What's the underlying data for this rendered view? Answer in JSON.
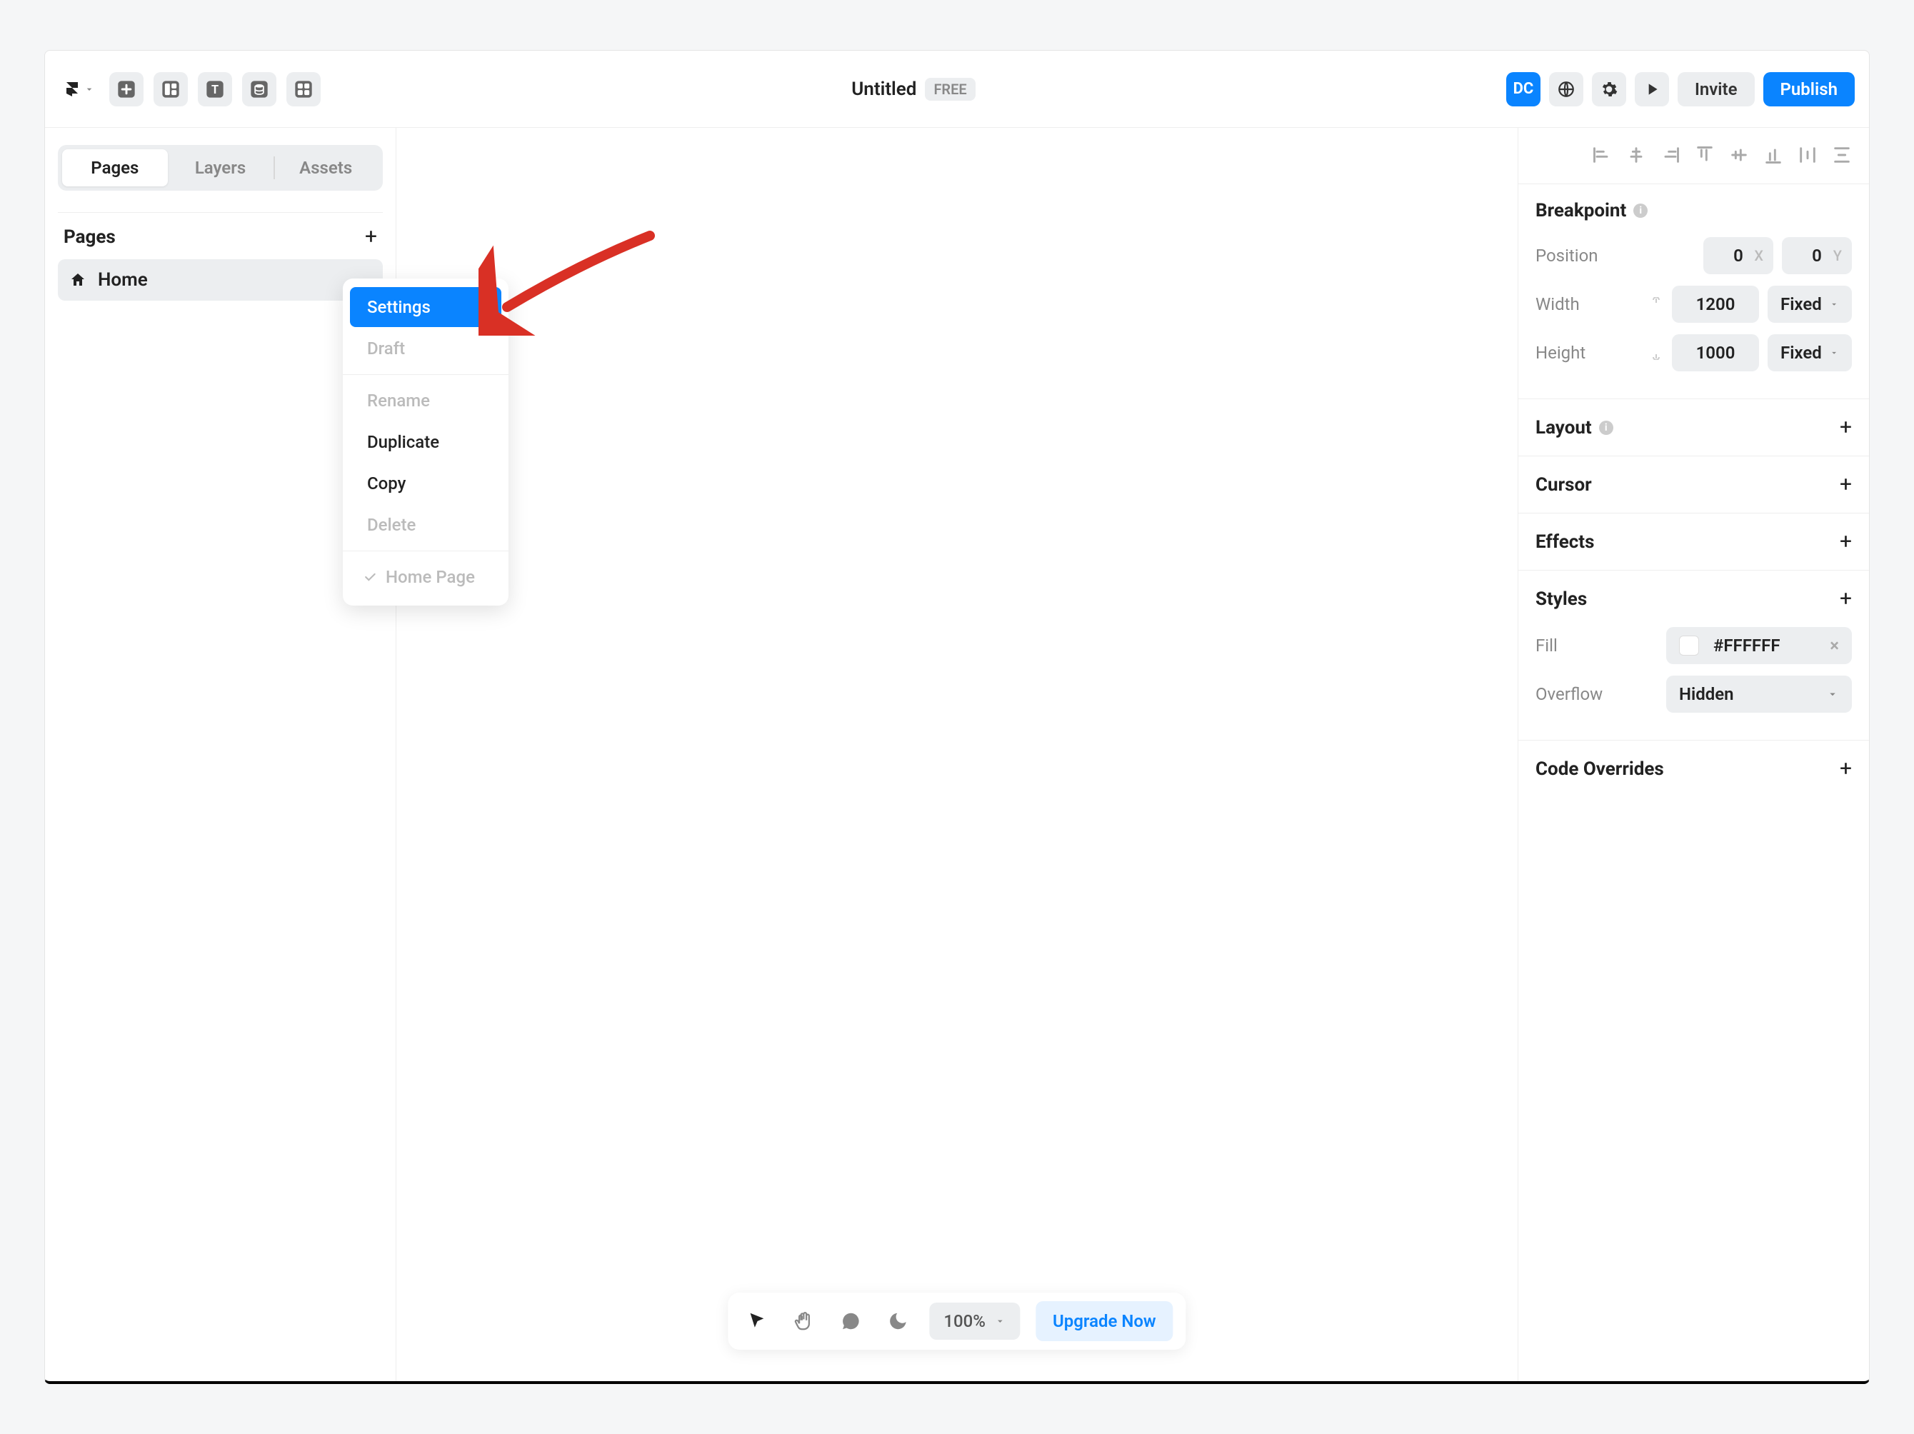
{
  "header": {
    "title": "Untitled",
    "badge": "FREE",
    "avatar": "DC",
    "invite": "Invite",
    "publish": "Publish"
  },
  "left_panel": {
    "tabs": [
      "Pages",
      "Layers",
      "Assets"
    ],
    "section_title": "Pages",
    "page_name": "Home"
  },
  "context_menu": {
    "settings": "Settings",
    "draft": "Draft",
    "rename": "Rename",
    "duplicate": "Duplicate",
    "copy": "Copy",
    "delete": "Delete",
    "home_page": "Home Page"
  },
  "right_panel": {
    "breakpoint": {
      "title": "Breakpoint",
      "position_label": "Position",
      "position_x": "0",
      "position_x_suffix": "X",
      "position_y": "0",
      "position_y_suffix": "Y",
      "width_label": "Width",
      "width_value": "1200",
      "width_mode": "Fixed",
      "height_label": "Height",
      "height_value": "1000",
      "height_mode": "Fixed"
    },
    "layout_title": "Layout",
    "cursor_title": "Cursor",
    "effects_title": "Effects",
    "styles": {
      "title": "Styles",
      "fill_label": "Fill",
      "fill_value": "#FFFFFF",
      "overflow_label": "Overflow",
      "overflow_value": "Hidden"
    },
    "code_overrides_title": "Code Overrides"
  },
  "bottom_bar": {
    "zoom": "100%",
    "upgrade": "Upgrade Now"
  }
}
